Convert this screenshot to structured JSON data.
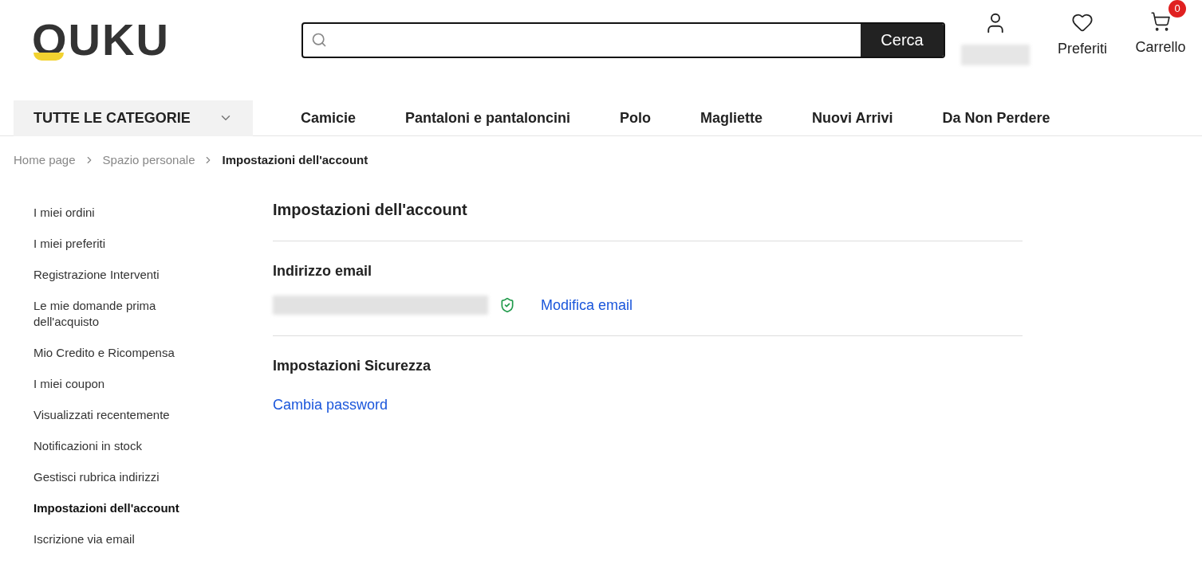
{
  "header": {
    "logo": "OUKU",
    "search": {
      "button": "Cerca"
    },
    "actions": [
      {
        "kind": "account"
      },
      {
        "kind": "wishlist",
        "label": "Preferiti"
      },
      {
        "kind": "cart",
        "label": "Carrello",
        "badge": "0"
      }
    ]
  },
  "nav": {
    "categories": "TUTTE LE CATEGORIE",
    "items": [
      "Camicie",
      "Pantaloni e pantaloncini",
      "Polo",
      "Magliette",
      "Nuovi Arrivi",
      "Da Non Perdere"
    ]
  },
  "breadcrumb": [
    {
      "label": "Home page",
      "current": false
    },
    {
      "label": "Spazio personale",
      "current": false
    },
    {
      "label": "Impostazioni dell'account",
      "current": true
    }
  ],
  "sidebar": {
    "items": [
      {
        "label": "I miei ordini",
        "selected": false
      },
      {
        "label": "I miei preferiti",
        "selected": false
      },
      {
        "label": "Registrazione Interventi",
        "selected": false
      },
      {
        "label": "Le mie domande prima dell'acquisto",
        "selected": false
      },
      {
        "label": "Mio Credito e Ricompensa",
        "selected": false
      },
      {
        "label": "I miei coupon",
        "selected": false
      },
      {
        "label": "Visualizzati recentemente",
        "selected": false
      },
      {
        "label": "Notificazioni in stock",
        "selected": false
      },
      {
        "label": "Gestisci rubrica indirizzi",
        "selected": false
      },
      {
        "label": "Impostazioni dell'account",
        "selected": true
      },
      {
        "label": "Iscrizione via email",
        "selected": false
      }
    ]
  },
  "main": {
    "title": "Impostazioni dell'account",
    "email": {
      "heading": "Indirizzo email",
      "verified": true,
      "link": "Modifica email"
    },
    "security": {
      "heading": "Impostazioni Sicurezza",
      "link": "Cambia password"
    }
  }
}
